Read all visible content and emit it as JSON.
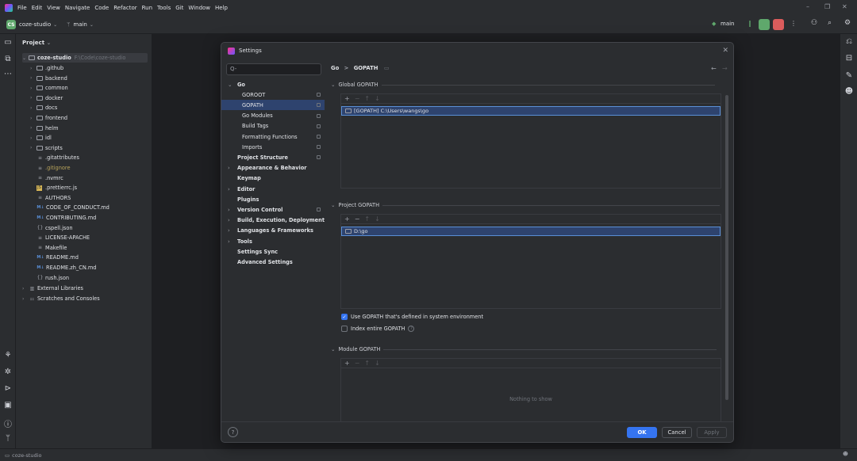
{
  "menu": [
    "File",
    "Edit",
    "View",
    "Navigate",
    "Code",
    "Refactor",
    "Run",
    "Tools",
    "Git",
    "Window",
    "Help"
  ],
  "toolbar": {
    "project_badge": "CS",
    "project_name": "coze-studio",
    "branch": "main",
    "run_branch": "main"
  },
  "project_panel": {
    "title": "Project",
    "root": {
      "name": "coze-studio",
      "path": "F:\\Code\\coze-studio"
    },
    "items": [
      {
        "label": ".github",
        "type": "folder"
      },
      {
        "label": "backend",
        "type": "folder"
      },
      {
        "label": "common",
        "type": "folder"
      },
      {
        "label": "docker",
        "type": "folder"
      },
      {
        "label": "docs",
        "type": "folder"
      },
      {
        "label": "frontend",
        "type": "folder"
      },
      {
        "label": "helm",
        "type": "folder"
      },
      {
        "label": "idl",
        "type": "folder"
      },
      {
        "label": "scripts",
        "type": "folder"
      },
      {
        "label": ".gitattributes",
        "type": "file"
      },
      {
        "label": ".gitignore",
        "type": "file"
      },
      {
        "label": ".nvmrc",
        "type": "file"
      },
      {
        "label": ".prettierrc.js",
        "type": "js"
      },
      {
        "label": "AUTHORS",
        "type": "file"
      },
      {
        "label": "CODE_OF_CONDUCT.md",
        "type": "md"
      },
      {
        "label": "CONTRIBUTING.md",
        "type": "md"
      },
      {
        "label": "cspell.json",
        "type": "json"
      },
      {
        "label": "LICENSE-APACHE",
        "type": "file"
      },
      {
        "label": "Makefile",
        "type": "file"
      },
      {
        "label": "README.md",
        "type": "md"
      },
      {
        "label": "README.zh_CN.md",
        "type": "md"
      },
      {
        "label": "rush.json",
        "type": "json"
      }
    ],
    "external": "External Libraries",
    "scratches": "Scratches and Consoles"
  },
  "status_bar": {
    "text": "coze-studio"
  },
  "dialog": {
    "title": "Settings",
    "search_placeholder": "Q-",
    "nav": [
      {
        "label": "Go",
        "bold": true,
        "arrow": "v"
      },
      {
        "label": "GOROOT",
        "indent": 2
      },
      {
        "label": "GOPATH",
        "indent": 2,
        "selected": true
      },
      {
        "label": "Go Modules",
        "indent": 2
      },
      {
        "label": "Build Tags",
        "indent": 2
      },
      {
        "label": "Formatting Functions",
        "indent": 2
      },
      {
        "label": "Imports",
        "indent": 2
      },
      {
        "label": "Project Structure",
        "bold": true
      },
      {
        "label": "Appearance & Behavior",
        "bold": true,
        "arrow": ">"
      },
      {
        "label": "Keymap",
        "bold": true
      },
      {
        "label": "Editor",
        "bold": true,
        "arrow": ">"
      },
      {
        "label": "Plugins",
        "bold": true
      },
      {
        "label": "Version Control",
        "bold": true,
        "arrow": ">"
      },
      {
        "label": "Build, Execution, Deployment",
        "bold": true,
        "arrow": ">"
      },
      {
        "label": "Languages & Frameworks",
        "bold": true,
        "arrow": ">"
      },
      {
        "label": "Tools",
        "bold": true,
        "arrow": ">"
      },
      {
        "label": "Settings Sync",
        "bold": true
      },
      {
        "label": "Advanced Settings",
        "bold": true
      }
    ],
    "breadcrumb": {
      "parent": "Go",
      "sep": ">",
      "current": "GOPATH"
    },
    "global_gopath": {
      "title": "Global GOPATH",
      "entry": "[GOPATH] C:\\Users\\wangs\\go"
    },
    "project_gopath": {
      "title": "Project GOPATH",
      "entry": "D:\\go"
    },
    "use_env": {
      "label": "Use GOPATH that's defined in system environment",
      "checked": true
    },
    "index_entire": {
      "label": "Index entire GOPATH",
      "checked": false
    },
    "module_gopath": {
      "title": "Module GOPATH",
      "empty_text": "Nothing to show"
    },
    "buttons": {
      "ok": "OK",
      "cancel": "Cancel",
      "apply": "Apply",
      "help": "?"
    }
  }
}
